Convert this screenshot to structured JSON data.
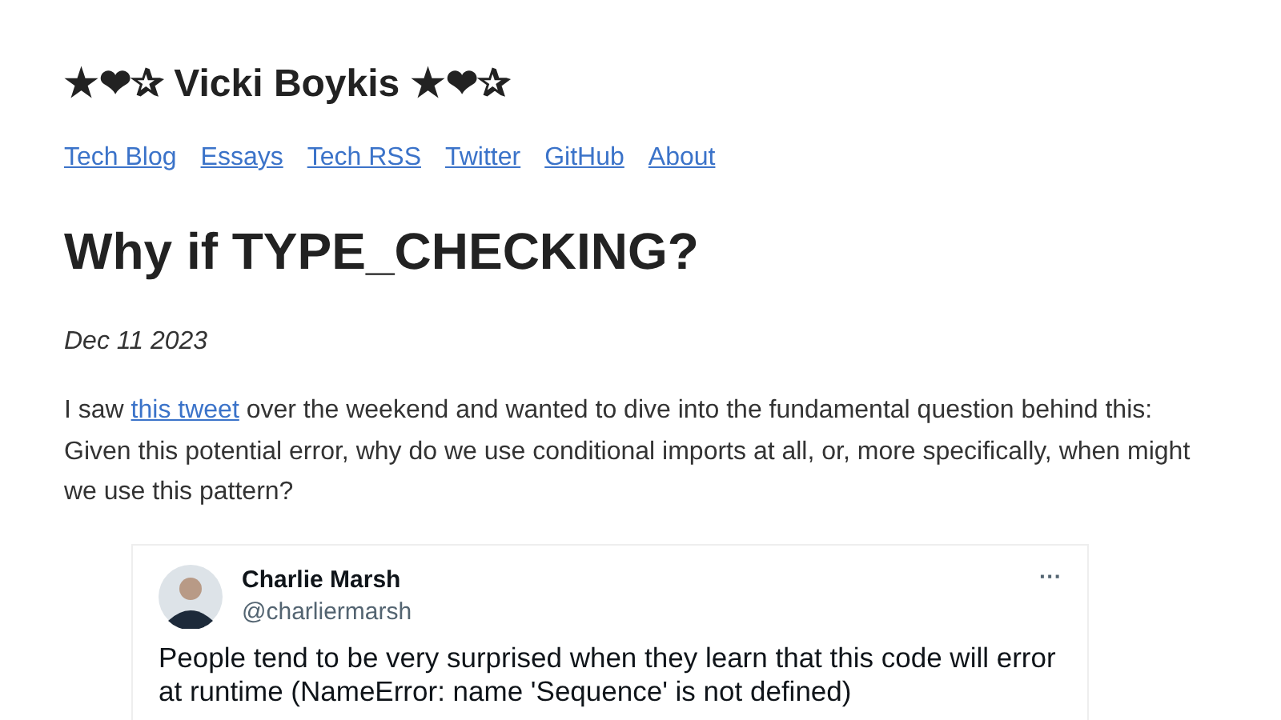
{
  "site_title": "★❤✰ Vicki Boykis ★❤✰",
  "nav": [
    {
      "label": "Tech Blog"
    },
    {
      "label": "Essays"
    },
    {
      "label": "Tech RSS"
    },
    {
      "label": "Twitter"
    },
    {
      "label": "GitHub"
    },
    {
      "label": "About"
    }
  ],
  "post": {
    "title": "Why if TYPE_CHECKING?",
    "date": "Dec 11 2023",
    "intro": {
      "before": "I saw ",
      "link": "this tweet",
      "after": " over the weekend and wanted to dive into the fundamental question behind this: Given this potential error, why do we use conditional imports at all, or, more specifically, when might we use this pattern?"
    },
    "tweet": {
      "name": "Charlie Marsh",
      "handle": "@charliermarsh",
      "menu": "···",
      "text_lines": [
        "People tend to be very surprised when they learn that this code will error",
        "at runtime (NameError: name 'Sequence' is not defined)"
      ]
    }
  }
}
